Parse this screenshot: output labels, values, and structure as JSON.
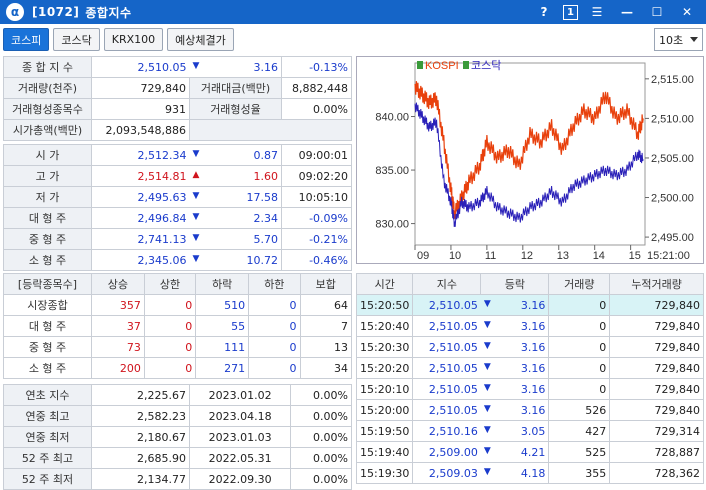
{
  "window": {
    "code": "[1072]",
    "title": "종합지수",
    "help": "?",
    "page": "1"
  },
  "tabs": [
    "코스피",
    "코스닥",
    "KRX100",
    "예상체결가"
  ],
  "interval": "10초",
  "summary": {
    "r1": [
      "종 합 지 수",
      "2,510.05",
      "3.16",
      "-0.13%"
    ],
    "r2": [
      "거래량(천주)",
      "729,840",
      "거래대금(백만)",
      "8,882,448"
    ],
    "r3": [
      "거래형성종목수",
      "931",
      "거래형성율",
      "0.00%"
    ],
    "r4": [
      "시가총액(백만)",
      "2,093,548,886"
    ]
  },
  "ohlc": [
    {
      "label": "시    가",
      "value": "2,512.34",
      "dir": "down",
      "chg": "0.87",
      "extra": "09:00:01",
      "vc": "blue",
      "cc": "blue",
      "ec": "black"
    },
    {
      "label": "고    가",
      "value": "2,514.81",
      "dir": "up",
      "chg": "1.60",
      "extra": "09:02:20",
      "vc": "red",
      "cc": "red",
      "ec": "black"
    },
    {
      "label": "저    가",
      "value": "2,495.63",
      "dir": "down",
      "chg": "17.58",
      "extra": "10:05:10",
      "vc": "blue",
      "cc": "blue",
      "ec": "black"
    },
    {
      "label": "대 형 주",
      "value": "2,496.84",
      "dir": "down",
      "chg": "2.34",
      "extra": "-0.09%",
      "vc": "blue",
      "cc": "blue",
      "ec": "blue"
    },
    {
      "label": "중 형 주",
      "value": "2,741.13",
      "dir": "down",
      "chg": "5.70",
      "extra": "-0.21%",
      "vc": "blue",
      "cc": "blue",
      "ec": "blue"
    },
    {
      "label": "소 형 주",
      "value": "2,345.06",
      "dir": "down",
      "chg": "10.72",
      "extra": "-0.46%",
      "vc": "blue",
      "cc": "blue",
      "ec": "blue"
    }
  ],
  "breadth": {
    "headers": [
      "[등락종목수]",
      "상승",
      "상한",
      "하락",
      "하한",
      "보합"
    ],
    "rows": [
      [
        "시장종합",
        "357",
        "0",
        "510",
        "0",
        "64"
      ],
      [
        "대 형 주",
        "37",
        "0",
        "55",
        "0",
        "7"
      ],
      [
        "중 형 주",
        "73",
        "0",
        "111",
        "0",
        "13"
      ],
      [
        "소 형 주",
        "200",
        "0",
        "271",
        "0",
        "34"
      ]
    ]
  },
  "yearly": [
    [
      "연초  지수",
      "2,225.67",
      "2023.01.02",
      "0.00%"
    ],
    [
      "연중  최고",
      "2,582.23",
      "2023.04.18",
      "0.00%"
    ],
    [
      "연중  최저",
      "2,180.67",
      "2023.01.03",
      "0.00%"
    ],
    [
      "52 주 최고",
      "2,685.90",
      "2022.05.31",
      "0.00%"
    ],
    [
      "52 주 최저",
      "2,134.77",
      "2022.09.30",
      "0.00%"
    ]
  ],
  "ticks": {
    "headers": [
      "시간",
      "지수",
      "등락",
      "거래량",
      "누적거래량"
    ],
    "rows": [
      [
        "15:20:50",
        "2,510.05",
        "3.16",
        "0",
        "729,840"
      ],
      [
        "15:20:40",
        "2,510.05",
        "3.16",
        "0",
        "729,840"
      ],
      [
        "15:20:30",
        "2,510.05",
        "3.16",
        "0",
        "729,840"
      ],
      [
        "15:20:20",
        "2,510.05",
        "3.16",
        "0",
        "729,840"
      ],
      [
        "15:20:10",
        "2,510.05",
        "3.16",
        "0",
        "729,840"
      ],
      [
        "15:20:00",
        "2,510.05",
        "3.16",
        "526",
        "729,840"
      ],
      [
        "15:19:50",
        "2,510.16",
        "3.05",
        "427",
        "729,314"
      ],
      [
        "15:19:40",
        "2,509.00",
        "4.21",
        "525",
        "728,887"
      ],
      [
        "15:19:30",
        "2,509.03",
        "4.18",
        "355",
        "728,362"
      ]
    ]
  },
  "chart_data": {
    "type": "line",
    "legend": [
      "KOSPI",
      "코스닥"
    ],
    "x_ticks": [
      "09",
      "10",
      "11",
      "12",
      "13",
      "14",
      "15"
    ],
    "right_axis": {
      "ticks": [
        "2,515.00",
        "2,510.00",
        "2,505.00",
        "2,500.00",
        "2,495.00"
      ],
      "range": [
        2494,
        2517
      ]
    },
    "left_axis": {
      "ticks": [
        "840.00",
        "835.00",
        "830.00"
      ],
      "range": [
        828,
        845
      ]
    },
    "time_label": "15:21:00",
    "series": [
      {
        "name": "KOSPI",
        "color": "#e8400c",
        "axis": "right",
        "x": [
          9.0,
          9.2,
          9.4,
          9.6,
          9.8,
          10.0,
          10.1,
          10.3,
          10.5,
          10.8,
          11.0,
          11.3,
          11.6,
          11.9,
          12.2,
          12.5,
          12.8,
          13.1,
          13.4,
          13.7,
          14.0,
          14.3,
          14.6,
          14.9,
          15.2,
          15.35
        ],
        "y": [
          2514,
          2513,
          2512,
          2512.5,
          2507,
          2501,
          2498,
          2500,
          2502,
          2504,
          2507,
          2505,
          2506,
          2504,
          2508,
          2507,
          2509,
          2506,
          2509,
          2511,
          2510,
          2513,
          2510,
          2511,
          2508,
          2510
        ]
      },
      {
        "name": "코스닥",
        "color": "#2a20b8",
        "axis": "left",
        "x": [
          9.0,
          9.2,
          9.4,
          9.6,
          9.8,
          10.0,
          10.1,
          10.3,
          10.5,
          10.8,
          11.0,
          11.3,
          11.6,
          11.9,
          12.2,
          12.5,
          12.8,
          13.1,
          13.4,
          13.7,
          14.0,
          14.3,
          14.6,
          14.9,
          15.2,
          15.35
        ],
        "y": [
          841,
          840,
          839,
          839.5,
          834,
          832,
          830,
          832,
          831.5,
          832,
          833,
          831.5,
          831,
          830.5,
          831.5,
          832,
          833,
          832,
          833.5,
          834,
          834.5,
          835,
          834.5,
          835,
          836.5,
          836
        ]
      }
    ]
  }
}
